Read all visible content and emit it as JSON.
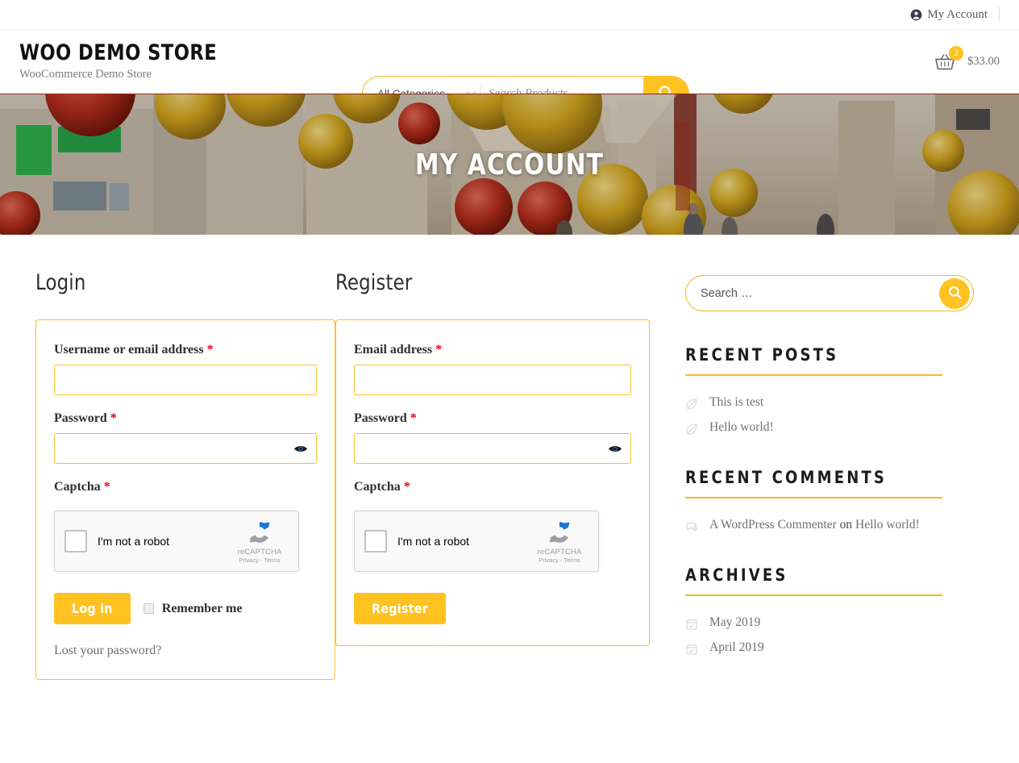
{
  "topbar": {
    "account_label": "My Account",
    "account_icon": "user-circle-icon"
  },
  "header": {
    "brand_title": "WOO DEMO STORE",
    "brand_subtitle": "WooCommerce Demo Store",
    "category_selected": "All Categories",
    "search_placeholder": "Search Products...",
    "search_value": "",
    "search_icon": "magnifier-icon",
    "cart_icon": "basket-icon",
    "cart_count": "2",
    "cart_total": "$33.00"
  },
  "hero": {
    "title": "MY ACCOUNT"
  },
  "login": {
    "heading": "Login",
    "username_label": "Username or email address",
    "username_value": "",
    "password_label": "Password",
    "password_value": "",
    "captcha_label": "Captcha",
    "required_mark": "*",
    "submit_label": "Log in",
    "remember_label": "Remember me",
    "lost_password_label": "Lost your password?"
  },
  "register": {
    "heading": "Register",
    "email_label": "Email address",
    "email_value": "",
    "password_label": "Password",
    "password_value": "",
    "captcha_label": "Captcha",
    "required_mark": "*",
    "submit_label": "Register"
  },
  "recaptcha": {
    "checkbox_label": "I'm not a robot",
    "brand": "reCAPTCHA",
    "terms": "Privacy - Terms"
  },
  "sidebar": {
    "search_placeholder": "Search …",
    "search_value": "",
    "widgets": [
      {
        "title": "RECENT POSTS",
        "items": [
          {
            "text": "This is test",
            "icon": "leaf-icon"
          },
          {
            "text": "Hello world!",
            "icon": "leaf-icon"
          }
        ]
      },
      {
        "title": "RECENT COMMENTS",
        "items": [
          {
            "author": "A WordPress Commenter",
            "on": "on",
            "post": "Hello world!",
            "icon": "comment-icon"
          }
        ]
      },
      {
        "title": "ARCHIVES",
        "items": [
          {
            "text": "May 2019",
            "icon": "calendar-icon"
          },
          {
            "text": "April 2019",
            "icon": "calendar-icon"
          }
        ]
      }
    ]
  },
  "colors": {
    "accent": "#FFC220",
    "accent_border": "#F5C02B",
    "required": "#E3000F",
    "text": "#3A3A3A",
    "muted": "#6F6F6F"
  }
}
